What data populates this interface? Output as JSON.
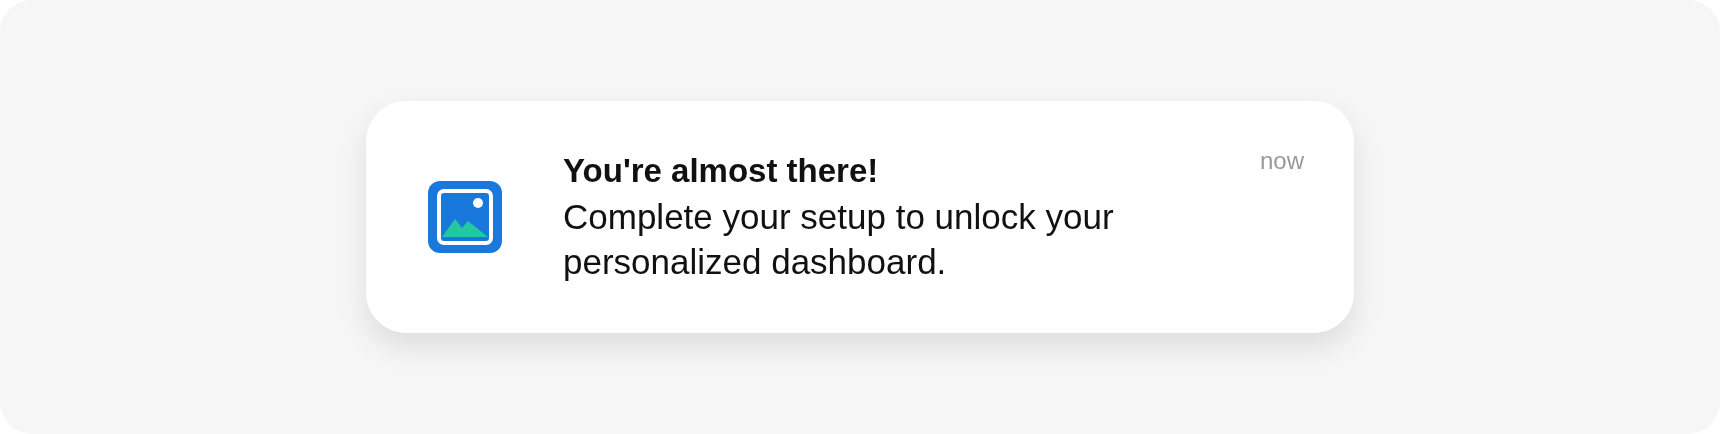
{
  "notification": {
    "title": "You're almost there!",
    "message": "Complete your setup to unlock your personalized dashboard.",
    "time": "now"
  }
}
